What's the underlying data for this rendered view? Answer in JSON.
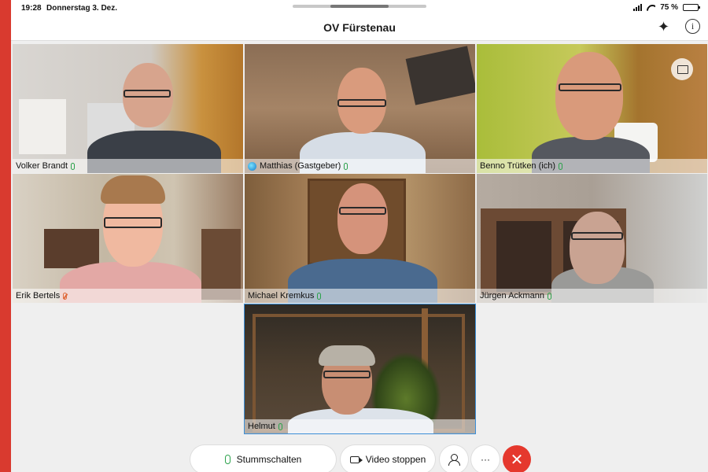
{
  "statusbar": {
    "time": "19:28",
    "date": "Donnerstag 3. Dez.",
    "battery": "75 %"
  },
  "meeting": {
    "title": "OV Fürstenau"
  },
  "participants": [
    {
      "name": "Volker Brandt",
      "muted": false
    },
    {
      "name": "Matthias (Gastgeber)",
      "muted": false,
      "host": true
    },
    {
      "name": "Benno Trütken (ich)",
      "muted": false
    },
    {
      "name": "Erik Bertels",
      "muted": true
    },
    {
      "name": "Michael Kremkus",
      "muted": false
    },
    {
      "name": "Jürgen Ackmann",
      "muted": false
    },
    {
      "name": "Helmut",
      "muted": false,
      "selected": true
    }
  ],
  "controls": {
    "mute_label": "Stummschalten",
    "video_label": "Video stoppen",
    "more_label": "···",
    "end_label": "✕"
  },
  "colors": {
    "accent": "#3b8fd8",
    "mic_on": "#2aa14a",
    "mic_muted": "#e06a3c",
    "end_call": "#e5382d"
  }
}
